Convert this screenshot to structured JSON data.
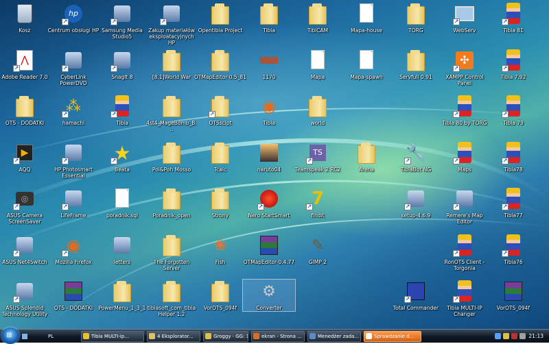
{
  "desktop": {
    "icons": [
      {
        "label": "Kosz",
        "icon": "recycle-bin-icon"
      },
      {
        "label": "Centrum obsługi HP",
        "icon": "hp-logo-icon"
      },
      {
        "label": "Samsung Media Studio5",
        "icon": "samsung-media-icon"
      },
      {
        "label": "Zakup materiałów eksploatacyjnych HP",
        "icon": "printer-supplies-icon"
      },
      {
        "label": "Opentibia Project",
        "icon": "folder-icon"
      },
      {
        "label": "Tibia",
        "icon": "folder-icon"
      },
      {
        "label": "TibiCAM",
        "icon": "folder-icon"
      },
      {
        "label": "Mapa-house",
        "icon": "document-icon"
      },
      {
        "label": "TORG",
        "icon": "folder-icon"
      },
      {
        "label": "WebServ",
        "icon": "computer-icon"
      },
      {
        "label": "Tibia 81",
        "icon": "tibia-character-icon"
      },
      {
        "label": "Adobe Reader 7.0",
        "icon": "pdf-icon"
      },
      {
        "label": "CyberLink PowerDVD",
        "icon": "dvd-player-icon"
      },
      {
        "label": "SnagIt 8",
        "icon": "snagit-icon"
      },
      {
        "label": "[8.1]World War",
        "icon": "folder-icon"
      },
      {
        "label": "OTMapEditor-0.5_81",
        "icon": "folder-icon"
      },
      {
        "label": "1170",
        "icon": "image-icon"
      },
      {
        "label": "Mapa",
        "icon": "map-file-icon"
      },
      {
        "label": "Mapa-spawn",
        "icon": "document-icon"
      },
      {
        "label": "Servfull 0.91",
        "icon": "folder-icon"
      },
      {
        "label": "XAMPP Control Panel",
        "icon": "xampp-icon"
      },
      {
        "label": "Tibia 7.92",
        "icon": "tibia-character-icon"
      },
      {
        "label": "OTS - DODATKI",
        "icon": "folder-icon"
      },
      {
        "label": "hamachi",
        "icon": "hamachi-icon"
      },
      {
        "label": "Tibia",
        "icon": "tibia-character-icon"
      },
      {
        "label": "4st4_MageBomb_B...",
        "icon": "folder-icon"
      },
      {
        "label": "OTSscipt",
        "icon": "folder-icon"
      },
      {
        "label": "Tibia",
        "icon": "firefox-icon"
      },
      {
        "label": "world",
        "icon": "folder-icon"
      },
      {
        "label": "Tibia 80 by TORG",
        "icon": "tibia-character-icon"
      },
      {
        "label": "Tibia 79",
        "icon": "tibia-character-icon"
      },
      {
        "label": "AQQ",
        "icon": "media-player-icon"
      },
      {
        "label": "HP Photosmart Essential",
        "icon": "photo-icon"
      },
      {
        "label": "Beata",
        "icon": "star-icon"
      },
      {
        "label": "Poi&Poh Mosso",
        "icon": "folder-icon"
      },
      {
        "label": "Tcalc",
        "icon": "folder-icon"
      },
      {
        "label": "naruto04",
        "icon": "picture-icon"
      },
      {
        "label": "Teamspeak 2 RC2",
        "icon": "teamspeak-icon"
      },
      {
        "label": "Arena",
        "icon": "folder-icon"
      },
      {
        "label": "TibiaBot NG",
        "icon": "wrench-icon"
      },
      {
        "label": "Maps",
        "icon": "tibia-character-icon"
      },
      {
        "label": "Tibia78",
        "icon": "tibia-character-icon"
      },
      {
        "label": "ASUS Camera ScreenSaver",
        "icon": "camera-icon"
      },
      {
        "label": "LifeFrame",
        "icon": "webcam-icon"
      },
      {
        "label": "poradnik.sql",
        "icon": "sql-file-icon"
      },
      {
        "label": "Poradnik_open",
        "icon": "folder-icon"
      },
      {
        "label": "Strony",
        "icon": "folder-icon"
      },
      {
        "label": "Nero StartSmart",
        "icon": "nero-icon"
      },
      {
        "label": "findit",
        "icon": "findit-icon"
      },
      {
        "label": "setup-4.6.9",
        "icon": "installer-icon"
      },
      {
        "label": "Remere's Map Editor",
        "icon": "map-editor-icon"
      },
      {
        "label": "Tibia77",
        "icon": "tibia-character-icon"
      },
      {
        "label": "ASUS Net4Switch",
        "icon": "network-icon"
      },
      {
        "label": "Mozilla Firefox",
        "icon": "firefox-icon"
      },
      {
        "label": "letters",
        "icon": "letters-icon"
      },
      {
        "label": "The Forgotten Server",
        "icon": "folder-icon"
      },
      {
        "label": "Fish",
        "icon": "fish-icon"
      },
      {
        "label": "OTMapEditor-0.4.77",
        "icon": "winrar-icon"
      },
      {
        "label": "GIMP 2",
        "icon": "gimp-icon"
      },
      {
        "label": "RonOTS Client - Torgonia",
        "icon": "tibia-character-icon"
      },
      {
        "label": "Tibia76",
        "icon": "tibia-character-icon"
      },
      {
        "label": "ASUS Splendid Technology Utility",
        "icon": "asus-splendid-icon"
      },
      {
        "label": "OTS - DODATKI",
        "icon": "winrar-icon"
      },
      {
        "label": "PowerMenu_1_3_1",
        "icon": "folder-icon"
      },
      {
        "label": "tibiasoft_com_tibia Helper 1.2",
        "icon": "folder-icon"
      },
      {
        "label": "VorOTS_094f",
        "icon": "folder-icon"
      },
      {
        "label": "Converter",
        "icon": "converter-icon"
      },
      {
        "label": "Total Commander",
        "icon": "floppy-disk-icon"
      },
      {
        "label": "Tibia MULTI-IP Changer",
        "icon": "tibia-character-icon"
      },
      {
        "label": "VorOTS_094f",
        "icon": "winrar-icon"
      }
    ]
  },
  "taskbar": {
    "start_icon": "windows-logo-icon",
    "language": "PL",
    "tasks": [
      {
        "label": "Tibia MULTI-ip..."
      },
      {
        "label": "4 Eksplorator..."
      },
      {
        "label": "Groggy · GG: 1..."
      },
      {
        "label": "ekran - Strona ..."
      },
      {
        "label": "Menedżer zada..."
      },
      {
        "label": "Sprawdzanie d..."
      }
    ],
    "clock": "21:13",
    "colors": {
      "active_task": "#e8782a",
      "taskbar": "#0e1822"
    }
  }
}
